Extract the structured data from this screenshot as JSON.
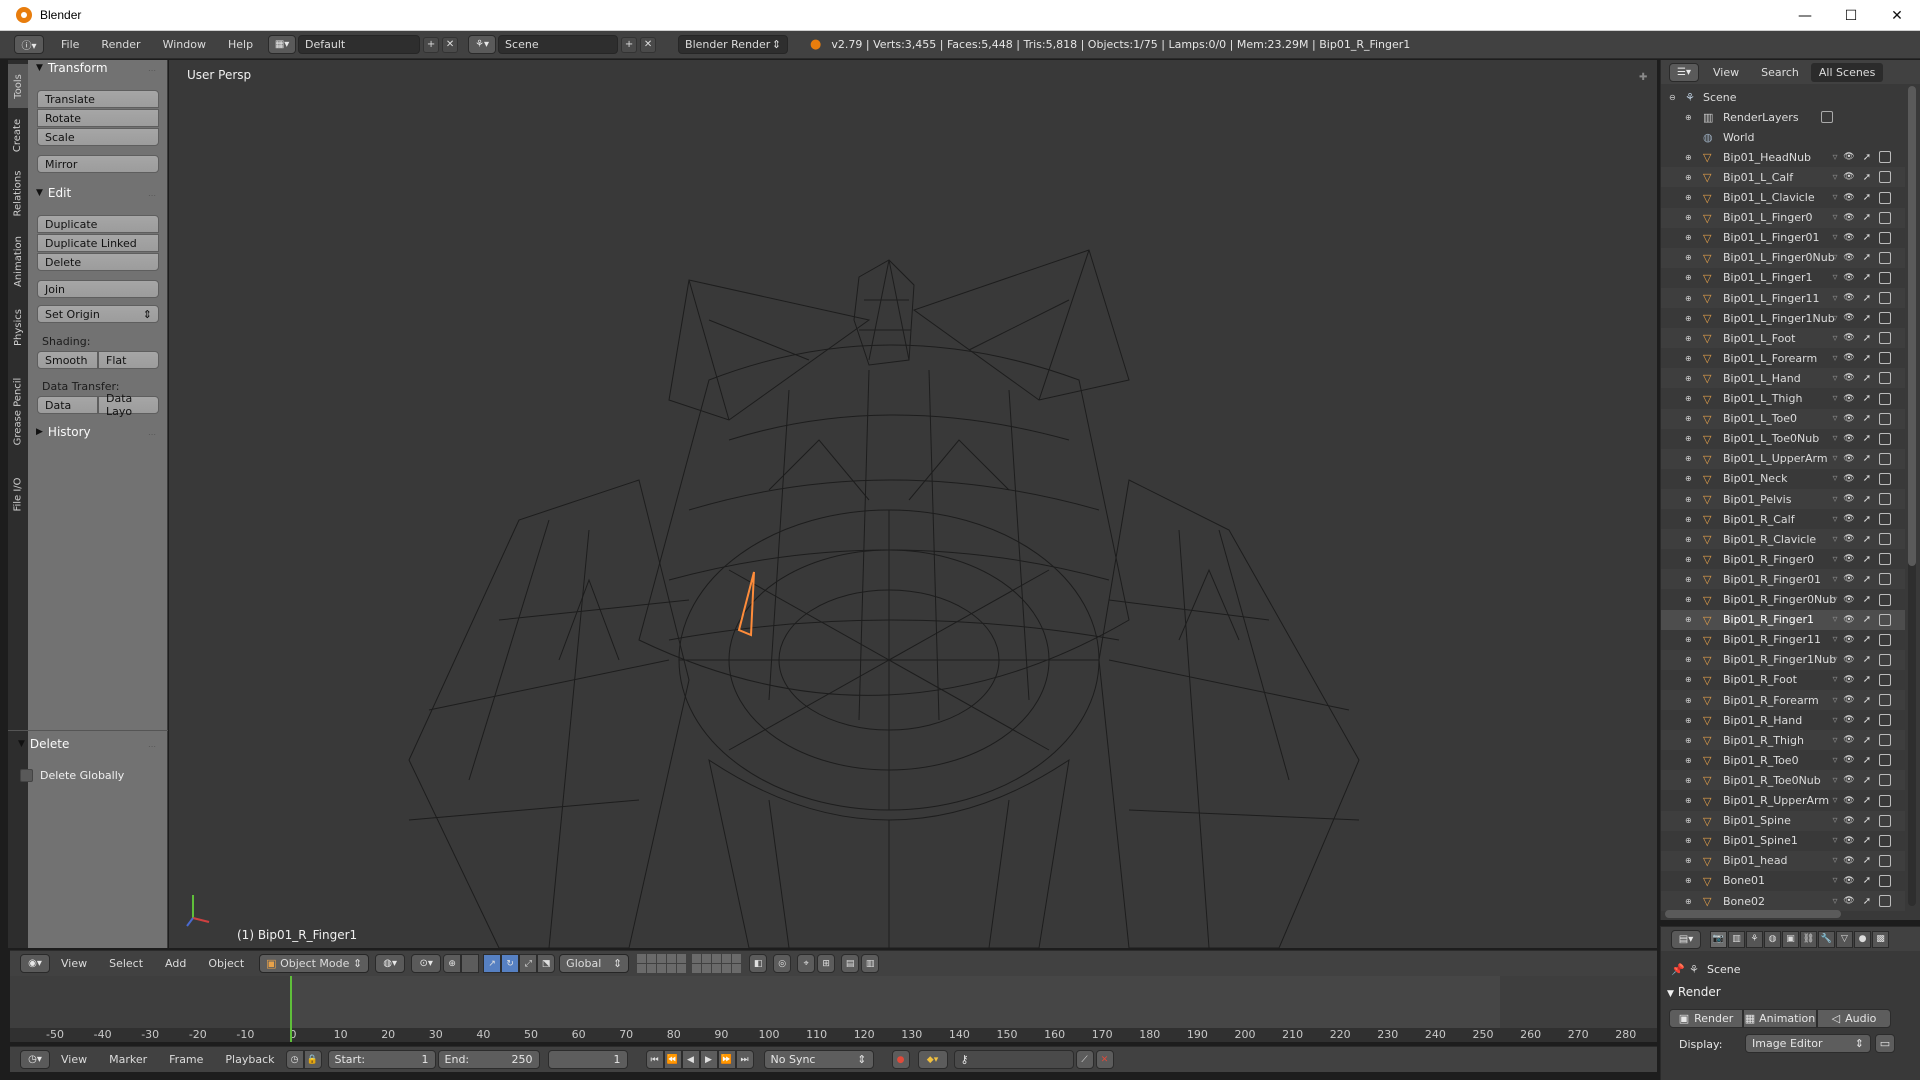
{
  "window": {
    "title": "Blender",
    "controls": [
      "—",
      "☐",
      "✕"
    ]
  },
  "info_header": {
    "menus": [
      "File",
      "Render",
      "Window",
      "Help"
    ],
    "layout": "Default",
    "scene": "Scene",
    "engine": "Blender Render",
    "stats": "v2.79 | Verts:3,455 | Faces:5,448 | Tris:5,818 | Objects:1/75 | Lamps:0/0 | Mem:23.29M | Bip01_R_Finger1"
  },
  "tool_tabs": [
    "Tools",
    "Create",
    "Relations",
    "Animation",
    "Physics",
    "Grease Pencil",
    "File I/O"
  ],
  "tool_shelf": {
    "transform": {
      "title": "Transform",
      "buttons": [
        "Translate",
        "Rotate",
        "Scale",
        "Mirror"
      ]
    },
    "edit": {
      "title": "Edit",
      "buttons": [
        "Duplicate",
        "Duplicate Linked",
        "Delete",
        "Join"
      ],
      "set_origin": "Set Origin",
      "shading_label": "Shading:",
      "smooth": "Smooth",
      "flat": "Flat",
      "data_transfer_label": "Data Transfer:",
      "data": "Data",
      "data_layout": "Data Layo"
    },
    "history": {
      "title": "History"
    },
    "operator": {
      "title": "Delete",
      "checkbox": "Delete Globally"
    }
  },
  "viewport": {
    "view_label": "User Persp",
    "active_object": "(1) Bip01_R_Finger1"
  },
  "viewport_header": {
    "menus": [
      "View",
      "Select",
      "Add",
      "Object"
    ],
    "mode": "Object Mode",
    "orientation": "Global"
  },
  "timeline": {
    "ticks": [
      "-50",
      "-40",
      "-30",
      "-20",
      "-10",
      "0",
      "10",
      "20",
      "30",
      "40",
      "50",
      "60",
      "70",
      "80",
      "90",
      "100",
      "110",
      "120",
      "130",
      "140",
      "150",
      "160",
      "170",
      "180",
      "190",
      "200",
      "210",
      "220",
      "230",
      "240",
      "250",
      "260",
      "270",
      "280"
    ],
    "current_frame": 1
  },
  "timeline_header": {
    "menus": [
      "View",
      "Marker",
      "Frame",
      "Playback"
    ],
    "start_label": "Start:",
    "start_value": "1",
    "end_label": "End:",
    "end_value": "250",
    "frame_value": "1",
    "sync": "No Sync"
  },
  "outliner": {
    "header": {
      "view": "View",
      "search": "Search",
      "filter": "All Scenes"
    },
    "scene": "Scene",
    "render_layers": "RenderLayers",
    "world": "World",
    "objects": [
      "Bip01_HeadNub",
      "Bip01_L_Calf",
      "Bip01_L_Clavicle",
      "Bip01_L_Finger0",
      "Bip01_L_Finger01",
      "Bip01_L_Finger0Nub",
      "Bip01_L_Finger1",
      "Bip01_L_Finger11",
      "Bip01_L_Finger1Nub",
      "Bip01_L_Foot",
      "Bip01_L_Forearm",
      "Bip01_L_Hand",
      "Bip01_L_Thigh",
      "Bip01_L_Toe0",
      "Bip01_L_Toe0Nub",
      "Bip01_L_UpperArm",
      "Bip01_Neck",
      "Bip01_Pelvis",
      "Bip01_R_Calf",
      "Bip01_R_Clavicle",
      "Bip01_R_Finger0",
      "Bip01_R_Finger01",
      "Bip01_R_Finger0Nub",
      "Bip01_R_Finger1",
      "Bip01_R_Finger11",
      "Bip01_R_Finger1Nub",
      "Bip01_R_Foot",
      "Bip01_R_Forearm",
      "Bip01_R_Hand",
      "Bip01_R_Thigh",
      "Bip01_R_Toe0",
      "Bip01_R_Toe0Nub",
      "Bip01_R_UpperArm",
      "Bip01_Spine",
      "Bip01_Spine1",
      "Bip01_head",
      "Bone01",
      "Bone02"
    ],
    "selected": "Bip01_R_Finger1"
  },
  "properties": {
    "context": "Scene",
    "panel": "Render",
    "buttons": [
      "Render",
      "Animation",
      "Audio"
    ],
    "display_label": "Display:",
    "display_value": "Image Editor"
  },
  "colors": {
    "accent_blue": "#5680c2",
    "object_orange": "#e87d0d",
    "playhead_green": "#5fbf3a",
    "selection_highlight": "#ff8c3a"
  }
}
